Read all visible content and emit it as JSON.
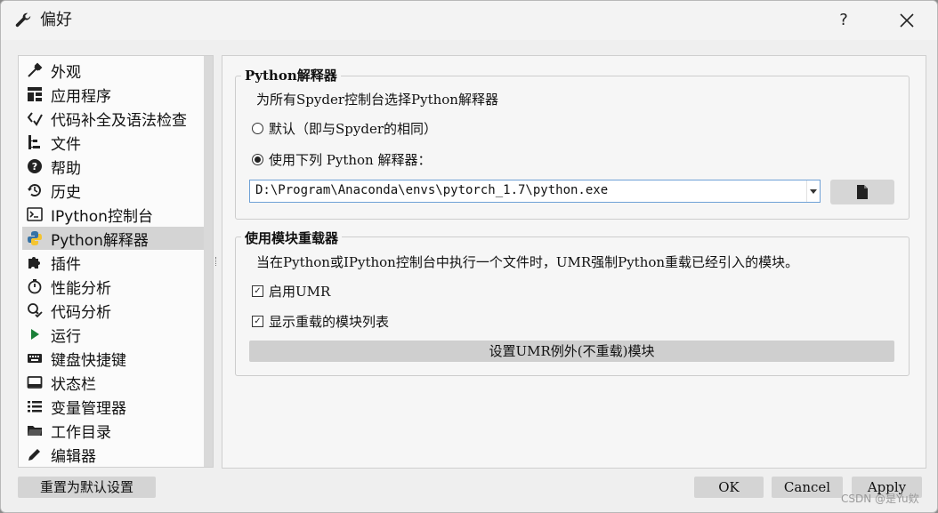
{
  "window": {
    "title": "偏好",
    "help_label": "?"
  },
  "sidebar": {
    "items": [
      {
        "label": "外观",
        "icon": "paint-brush-icon"
      },
      {
        "label": "应用程序",
        "icon": "layout-icon"
      },
      {
        "label": "代码补全及语法检查",
        "icon": "code-completion-icon"
      },
      {
        "label": "文件",
        "icon": "file-tree-icon"
      },
      {
        "label": "帮助",
        "icon": "help-circle-icon"
      },
      {
        "label": "历史",
        "icon": "history-icon"
      },
      {
        "label": "IPython控制台",
        "icon": "console-icon"
      },
      {
        "label": "Python解释器",
        "icon": "python-icon",
        "selected": true
      },
      {
        "label": "插件",
        "icon": "puzzle-icon"
      },
      {
        "label": "性能分析",
        "icon": "stopwatch-icon"
      },
      {
        "label": "代码分析",
        "icon": "code-analysis-icon"
      },
      {
        "label": "运行",
        "icon": "play-icon"
      },
      {
        "label": "键盘快捷键",
        "icon": "keyboard-icon"
      },
      {
        "label": "状态栏",
        "icon": "statusbar-icon"
      },
      {
        "label": "变量管理器",
        "icon": "list-icon"
      },
      {
        "label": "工作目录",
        "icon": "folder-icon"
      },
      {
        "label": "编辑器",
        "icon": "pencil-icon"
      }
    ]
  },
  "interpreter": {
    "group_title": "Python解释器",
    "description": "为所有Spyder控制台选择Python解释器",
    "default_option": "默认（即与Spyder的相同）",
    "custom_option": "使用下列 Python 解释器：",
    "path_value": "D:\\Program\\Anaconda\\envs\\pytorch_1.7\\python.exe"
  },
  "umr": {
    "group_title": "使用模块重载器",
    "description": "当在Python或IPython控制台中执行一个文件时，UMR强制Python重载已经引入的模块。",
    "enable_label": "启用UMR",
    "show_list_label": "显示重载的模块列表",
    "exclusions_button": "设置UMR例外(不重载)模块"
  },
  "footer": {
    "reset_label": "重置为默认设置",
    "ok_label": "OK",
    "cancel_label": "Cancel",
    "apply_label": "Apply"
  },
  "watermark": "CSDN @是Yu欸",
  "colors": {
    "accent_python_blue": "#3572a5",
    "accent_python_yellow": "#f4c430",
    "run_green": "#1a7f37"
  }
}
